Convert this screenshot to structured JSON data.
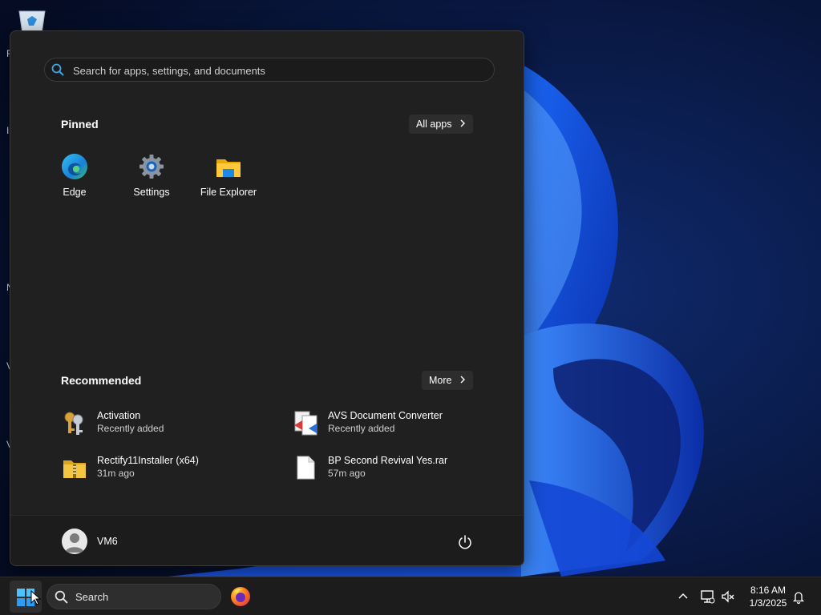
{
  "start_menu": {
    "search": {
      "placeholder": "Search for apps, settings, and documents"
    },
    "pinned": {
      "title": "Pinned",
      "all_apps_label": "All apps",
      "apps": [
        {
          "label": "Edge",
          "icon": "edge-icon"
        },
        {
          "label": "Settings",
          "icon": "settings-gear-icon"
        },
        {
          "label": "File Explorer",
          "icon": "folder-icon"
        }
      ]
    },
    "recommended": {
      "title": "Recommended",
      "more_label": "More",
      "items": [
        {
          "name": "Activation",
          "subtitle": "Recently added",
          "icon": "keys-icon"
        },
        {
          "name": "AVS Document Converter",
          "subtitle": "Recently added",
          "icon": "avs-converter-icon"
        },
        {
          "name": "Rectify11Installer (x64)",
          "subtitle": "31m ago",
          "icon": "zip-folder-icon"
        },
        {
          "name": "BP Second Revival Yes.rar",
          "subtitle": "57m ago",
          "icon": "file-icon"
        }
      ]
    },
    "user": {
      "name": "VM6"
    }
  },
  "taskbar": {
    "search_label": "Search",
    "time": "8:16 AM",
    "date": "1/3/2025"
  },
  "colors": {
    "menu_bg": "#202020",
    "taskbar_bg": "#1c1c1c",
    "accent": "#0078d4"
  }
}
